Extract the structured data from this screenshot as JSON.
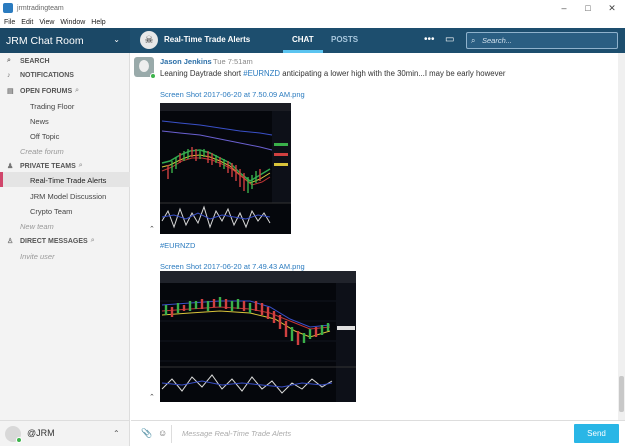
{
  "window": {
    "title": "jrmtradingteam",
    "minimize": "–",
    "maximize": "□",
    "close": "✕"
  },
  "menu": [
    "File",
    "Edit",
    "View",
    "Window",
    "Help"
  ],
  "header": {
    "community": "JRM Chat Room",
    "room": "Real-Time Trade Alerts",
    "tabs": [
      {
        "label": "CHAT",
        "active": true
      },
      {
        "label": "POSTS",
        "active": false
      }
    ],
    "search_placeholder": "Search..."
  },
  "sidebar": {
    "search": "SEARCH",
    "notifications": "NOTIFICATIONS",
    "open_forums": "OPEN FORUMS",
    "forums": [
      "Trading Floor",
      "News",
      "Off Topic"
    ],
    "create_forum": "Create forum",
    "private_teams": "PRIVATE TEAMS",
    "teams": [
      "Real-Time Trade Alerts",
      "JRM Model Discussion",
      "Crypto Team"
    ],
    "new_team": "New team",
    "direct_messages": "DIRECT MESSAGES",
    "invite_user": "Invite user",
    "user": "@JRM"
  },
  "message": {
    "author": "Jason Jenkins",
    "time": "Tue 7:51am",
    "text_before": "Leaning Daytrade short ",
    "text_tag": "#EURNZD",
    "text_after": " anticipating a lower high with the 30min...I may be early however",
    "attachment1": "Screen Shot 2017-06-20 at 7.50.09 AM.png",
    "hashtag": "#EURNZD",
    "attachment2": "Screen Shot 2017-06-20 at 7.49.43 AM.png"
  },
  "composer": {
    "placeholder": "Message Real-Time Trade Alerts",
    "send": "Send"
  },
  "colors": {
    "topbar": "#1d4e6e",
    "accent": "#29b6e6",
    "active_marker": "#d0466b",
    "link": "#2b7bbf"
  }
}
